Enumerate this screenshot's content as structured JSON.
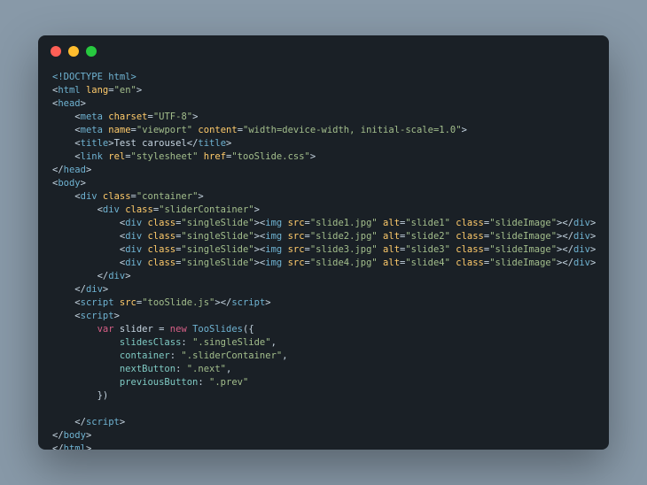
{
  "code": {
    "doctype": "<!DOCTYPE html>",
    "html_open_tag": "html",
    "html_open_attr_n": "lang",
    "html_open_attr_v": "\"en\"",
    "head_tag": "head",
    "meta1_tag": "meta",
    "meta1_attr_n": "charset",
    "meta1_attr_v": "\"UTF-8\"",
    "meta2_tag": "meta",
    "meta2_a1n": "name",
    "meta2_a1v": "\"viewport\"",
    "meta2_a2n": "content",
    "meta2_a2v": "\"width=device-width, initial-scale=1.0\"",
    "title_tag": "title",
    "title_text": "Test carousel",
    "link_tag": "link",
    "link_a1n": "rel",
    "link_a1v": "\"stylesheet\"",
    "link_a2n": "href",
    "link_a2v": "\"tooSlide.css\"",
    "body_tag": "body",
    "div_tag": "div",
    "class_kw": "class",
    "container_v": "\"container\"",
    "sliderContainer_v": "\"sliderContainer\"",
    "singleSlide_v": "\"singleSlide\"",
    "img_tag": "img",
    "src_n": "src",
    "alt_n": "alt",
    "slideImage_v": "\"slideImage\"",
    "slide1_src": "\"slide1.jpg\"",
    "slide1_alt": "\"slide1\"",
    "slide2_src": "\"slide2.jpg\"",
    "slide2_alt": "\"slide2\"",
    "slide3_src": "\"slide3.jpg\"",
    "slide3_alt": "\"slide3\"",
    "slide4_src": "\"slide4.jpg\"",
    "slide4_alt": "\"slide4\"",
    "script_tag": "script",
    "script_src_v": "\"tooSlide.js\"",
    "var_kw": "var",
    "slider_var": "slider",
    "new_kw": "new",
    "ctor": "TooSlides",
    "prop1": "slidesClass",
    "val1": "\".singleSlide\"",
    "prop2": "container",
    "val2": "\".sliderContainer\"",
    "prop3": "nextButton",
    "val3": "\".next\"",
    "prop4": "previousButton",
    "val4": "\".prev\""
  }
}
